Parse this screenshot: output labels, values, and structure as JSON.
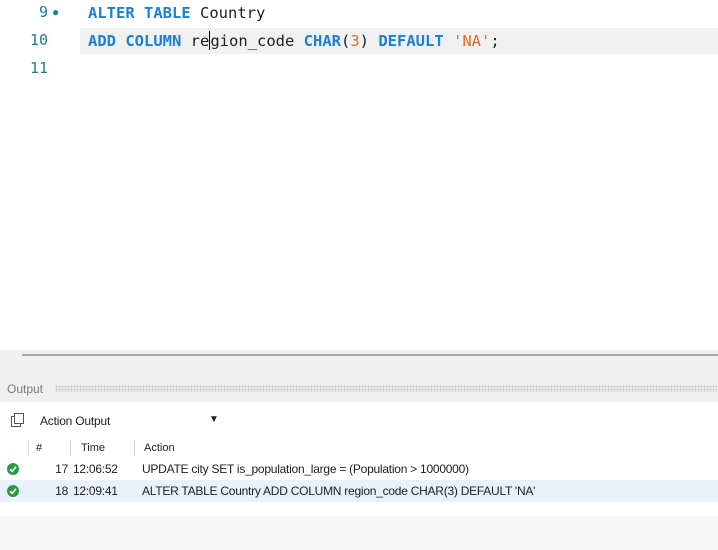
{
  "editor": {
    "lines": [
      {
        "number": "9",
        "marker": "●",
        "tokens": [
          "ALTER TABLE",
          " Country"
        ]
      },
      {
        "number": "10",
        "tokens_pre": "ADD COLUMN",
        "tokens_mid_a": " re",
        "tokens_mid_b": "gion_code ",
        "kw2": "CHAR",
        "paren_open": "(",
        "num": "3",
        "paren_close": ") ",
        "kw3": "DEFAULT",
        "space": " ",
        "str": "'NA'",
        "end": ";"
      },
      {
        "number": "11"
      }
    ]
  },
  "output": {
    "title": "Output",
    "dropdown": {
      "selected": "Action Output"
    },
    "columns": {
      "index": "#",
      "time": "Time",
      "action": "Action"
    },
    "rows": [
      {
        "index": "17",
        "time": "12:06:52",
        "action": "UPDATE city  SET is_population_large = (Population > 1000000)",
        "status": "success"
      },
      {
        "index": "18",
        "time": "12:09:41",
        "action": "ALTER TABLE Country  ADD COLUMN region_code CHAR(3) DEFAULT 'NA'",
        "status": "success"
      }
    ]
  },
  "colors": {
    "keyword": "#1a7fd6",
    "literal": "#e06c24",
    "line_number": "#1d8089",
    "success": "#2a9c3f",
    "selected_row": "#e9f1fb"
  }
}
